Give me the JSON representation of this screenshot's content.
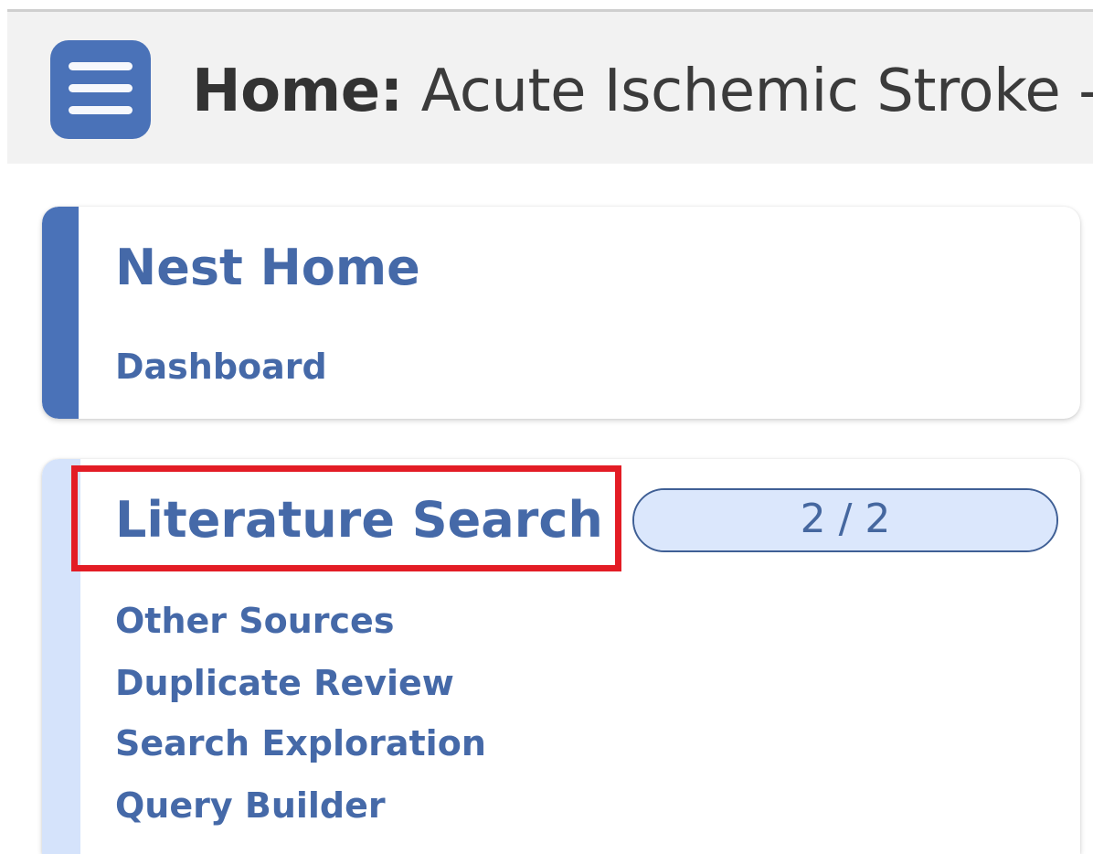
{
  "header": {
    "title_bold": "Home:",
    "title_rest": " Acute Ischemic Stroke -",
    "menu_icon": "hamburger-menu-icon"
  },
  "cards": [
    {
      "title": "Nest Home",
      "links": [
        "Dashboard"
      ]
    },
    {
      "title": "Literature Search",
      "progress": {
        "label": "2 / 2",
        "fraction": 1.0
      },
      "links": [
        "Other Sources",
        "Duplicate Review",
        "Search Exploration",
        "Query Builder"
      ]
    }
  ],
  "colors": {
    "accent": "#4a72b8",
    "link": "#4569a8",
    "highlight": "#e31c25",
    "progress_bg": "#dbe7fc"
  }
}
